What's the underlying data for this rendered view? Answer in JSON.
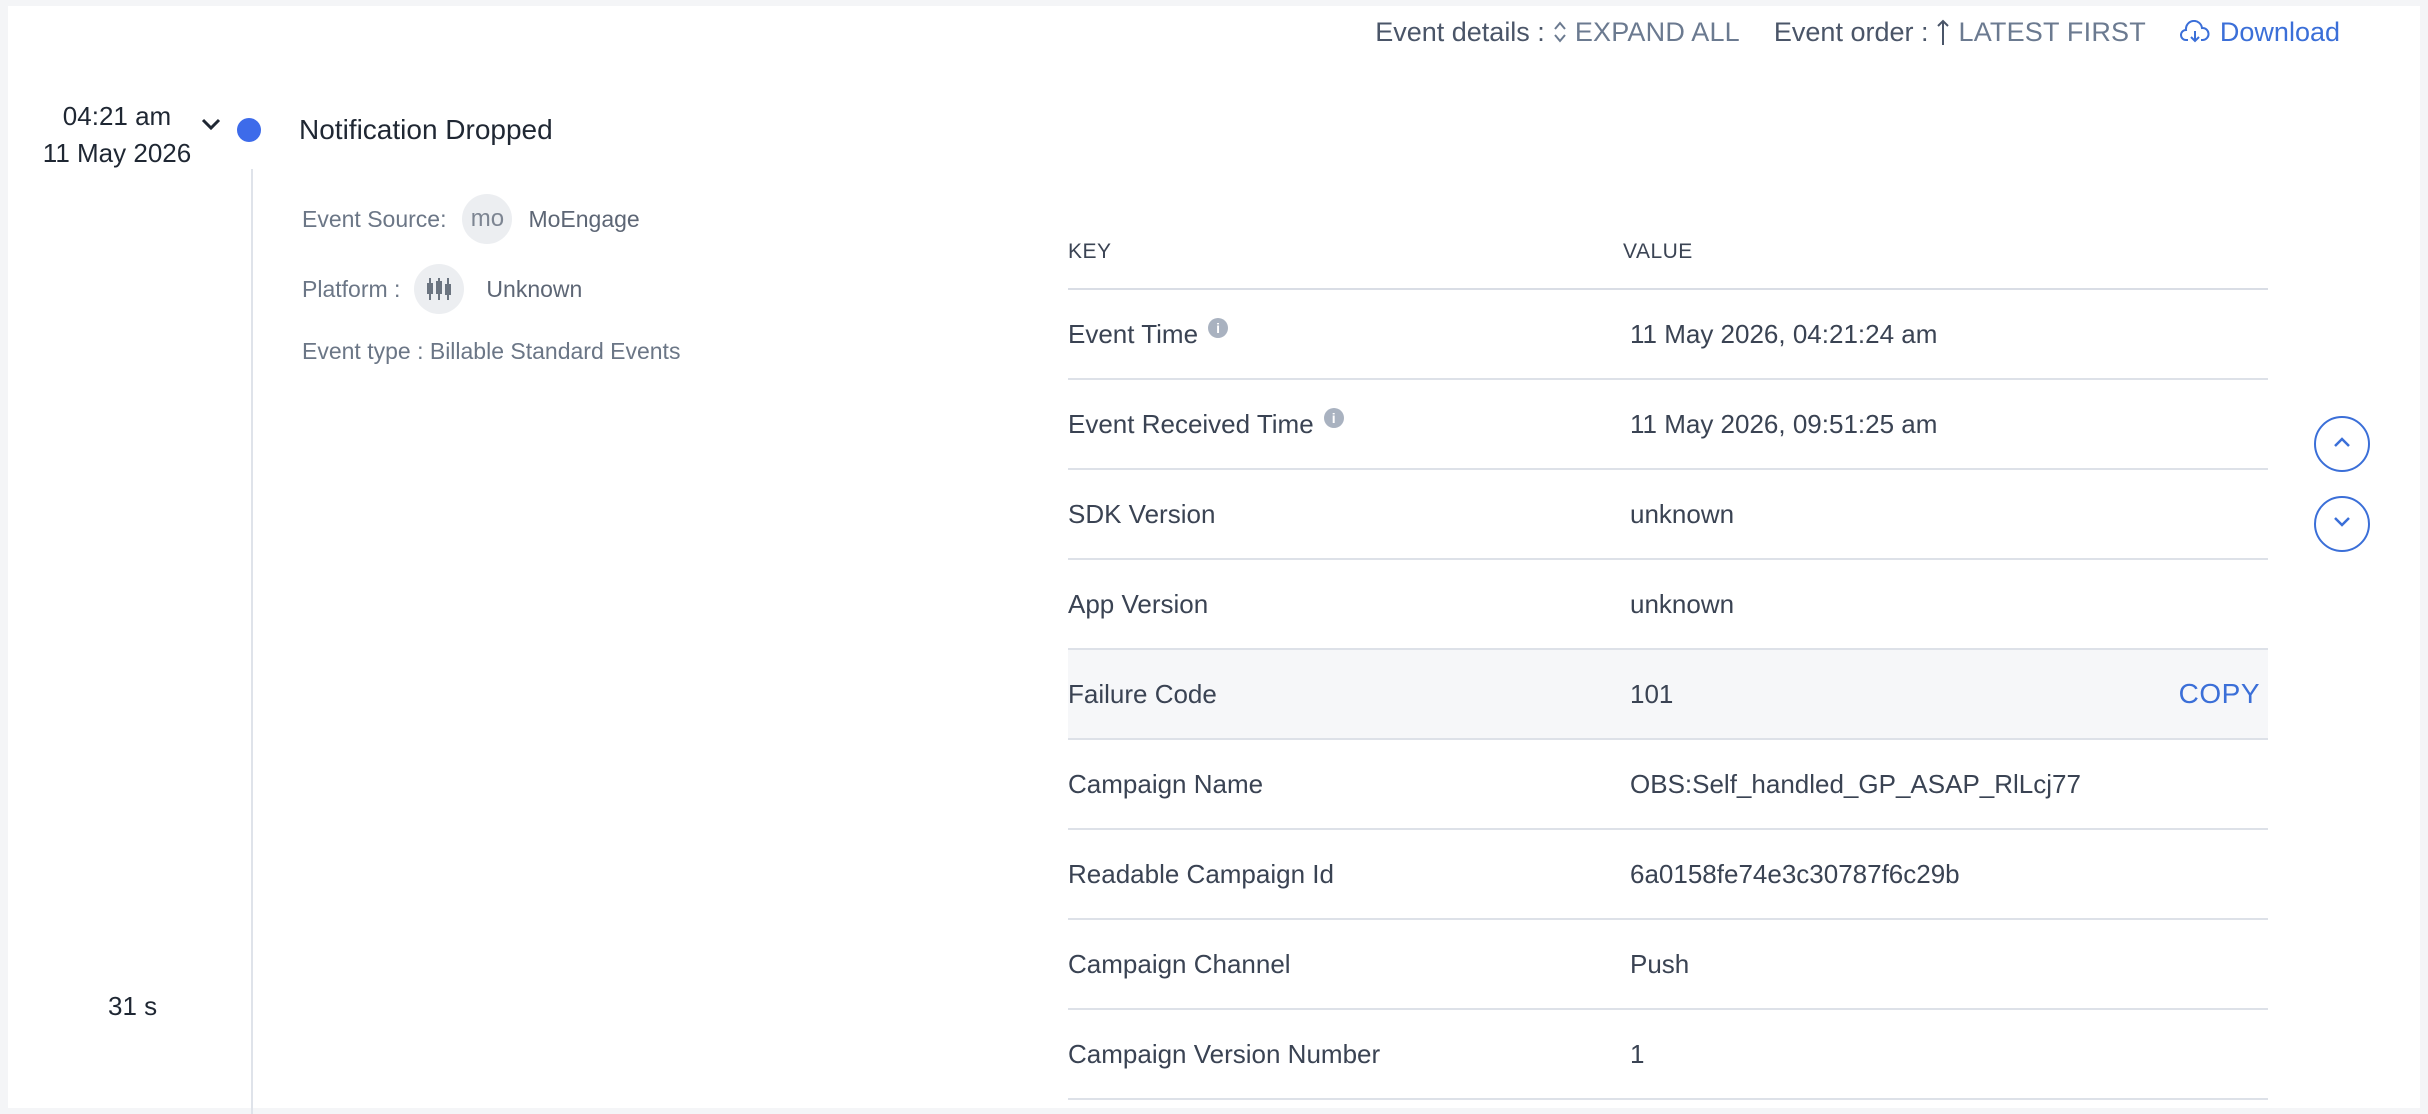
{
  "toolbar": {
    "event_details_label": "Event details :",
    "expand_all": "EXPAND ALL",
    "event_order_label": "Event order :",
    "latest_first": "LATEST FIRST",
    "download": "Download"
  },
  "event": {
    "time": "04:21 am",
    "date": "11 May 2026",
    "title": "Notification Dropped",
    "duration": "31 s",
    "source_label": "Event Source:",
    "source_badge": "mo",
    "source_value": "MoEngage",
    "platform_label": "Platform :",
    "platform_value": "Unknown",
    "type_text": "Event type : Billable Standard Events"
  },
  "table": {
    "headers": {
      "key": "KEY",
      "value": "VALUE"
    },
    "rows": [
      {
        "key": "Event Time",
        "value": "11 May 2026, 04:21:24 am",
        "info": true
      },
      {
        "key": "Event Received Time",
        "value": "11 May 2026, 09:51:25 am",
        "info": true
      },
      {
        "key": "SDK Version",
        "value": "unknown"
      },
      {
        "key": "App Version",
        "value": "unknown"
      },
      {
        "key": "Failure Code",
        "value": "101",
        "copy": "COPY"
      },
      {
        "key": "Campaign Name",
        "value": "OBS:Self_handled_GP_ASAP_RlLcj77"
      },
      {
        "key": "Readable Campaign Id",
        "value": "6a0158fe74e3c30787f6c29b"
      },
      {
        "key": "Campaign Channel",
        "value": "Push"
      },
      {
        "key": "Campaign Version Number",
        "value": "1"
      }
    ]
  },
  "colors": {
    "accent": "#3b6fd8",
    "dot": "#3d6bea",
    "info_icon": "#a9b2c0"
  },
  "icons": [
    "expand-icon",
    "arrow-up-icon",
    "cloud-download-icon",
    "chevron-down-icon",
    "platform-icon",
    "info-icon",
    "chevron-up-icon"
  ]
}
